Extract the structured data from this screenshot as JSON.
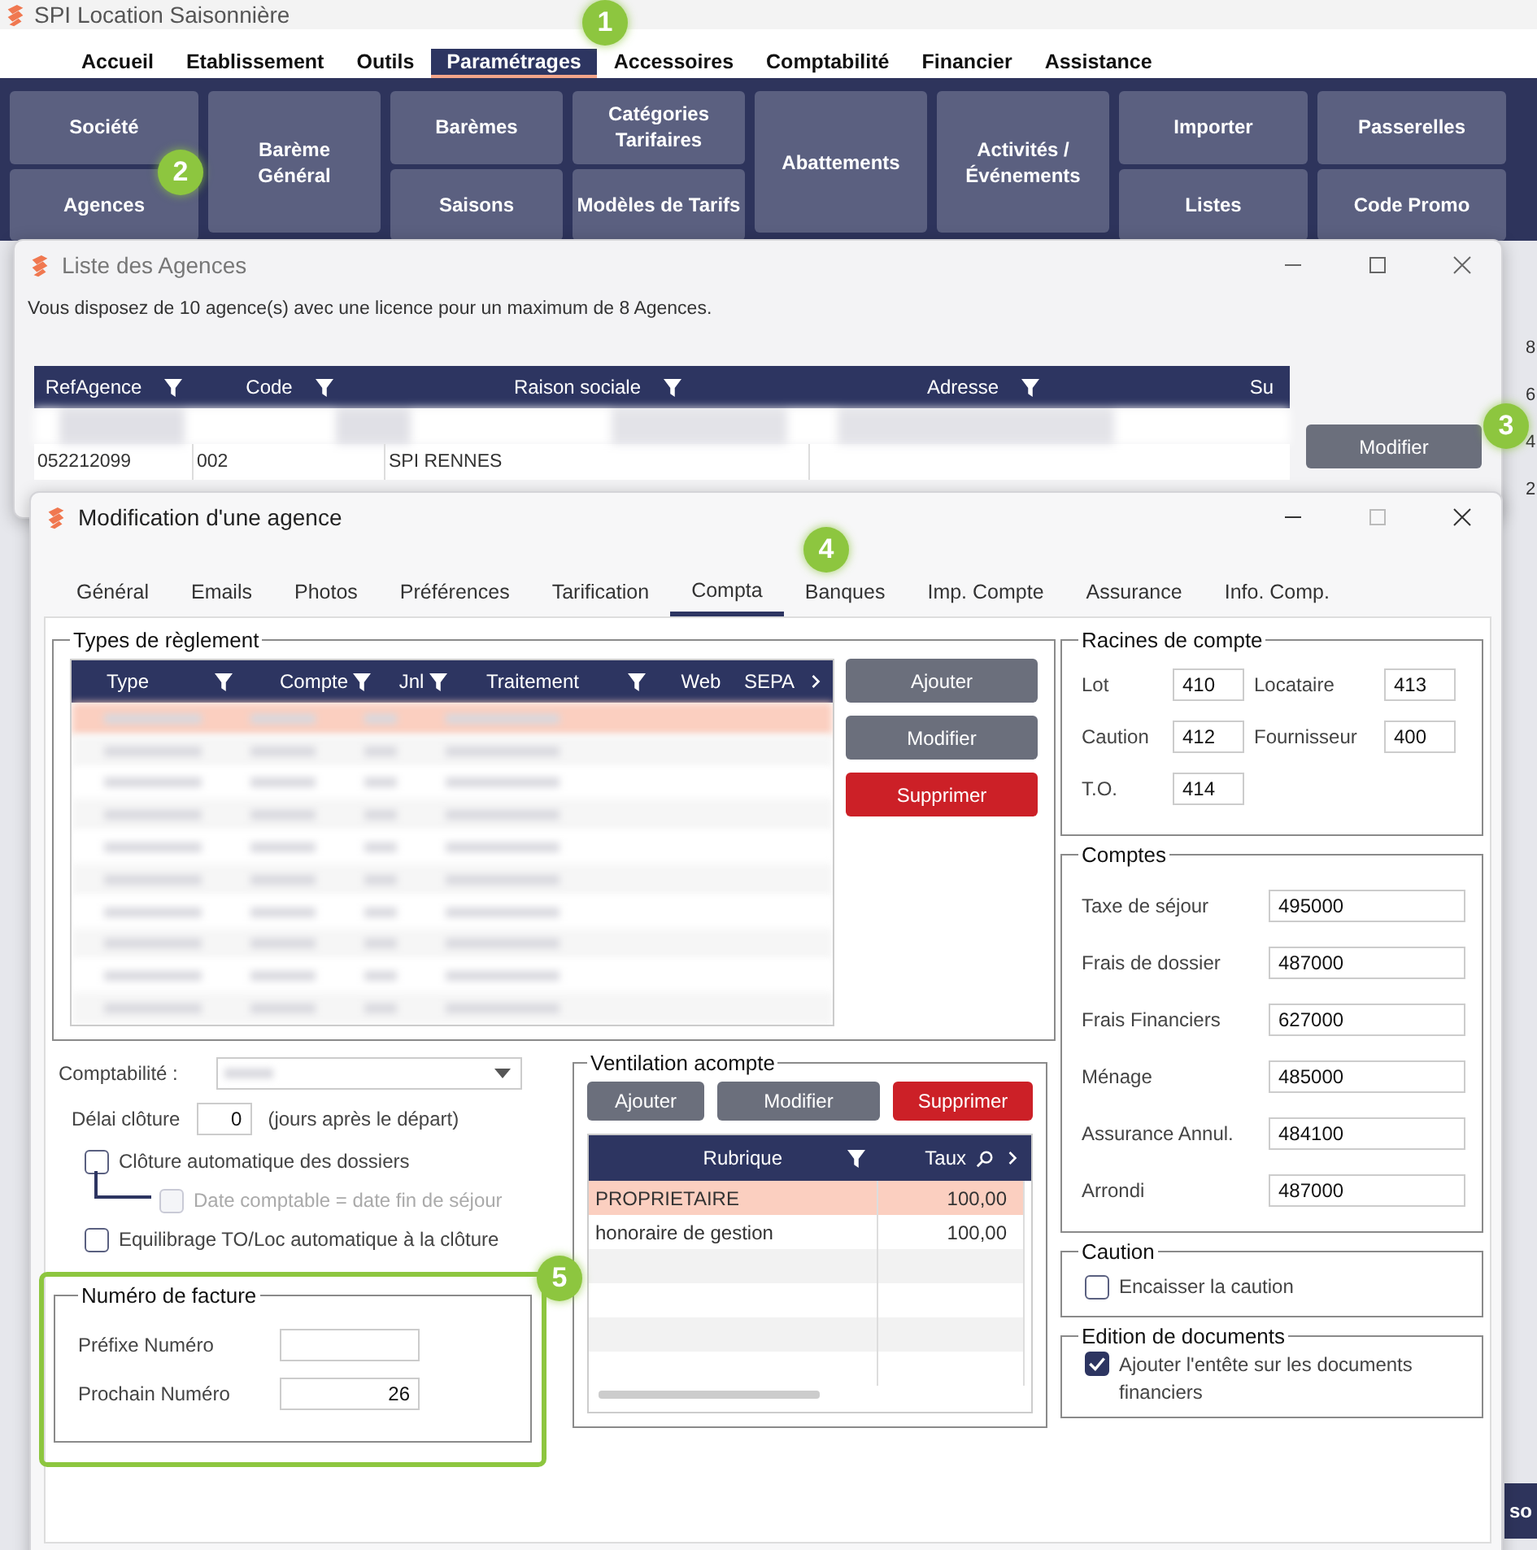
{
  "app": {
    "title": "SPI Location Saisonnière"
  },
  "menu": [
    {
      "label": "Accueil",
      "selected": false
    },
    {
      "label": "Etablissement",
      "selected": false
    },
    {
      "label": "Outils",
      "selected": false
    },
    {
      "label": "Paramétrages",
      "selected": true
    },
    {
      "label": "Accessoires",
      "selected": false
    },
    {
      "label": "Comptabilité",
      "selected": false
    },
    {
      "label": "Financier",
      "selected": false
    },
    {
      "label": "Assistance",
      "selected": false
    }
  ],
  "ribbon": [
    [
      "Société",
      "Agences"
    ],
    [
      "Barème\nGénéral"
    ],
    [
      "Barèmes",
      "Saisons"
    ],
    [
      "Catégories\nTarifaires",
      "Modèles de Tarifs"
    ],
    [
      "Abattements"
    ],
    [
      "Activités /\nÉvénements"
    ],
    [
      "Importer",
      "Listes"
    ],
    [
      "Passerelles",
      "Code Promo"
    ]
  ],
  "background_axis": [
    "8",
    "6",
    "4",
    "2"
  ],
  "background_fragment": "so",
  "agency_list": {
    "title": "Liste des Agences",
    "info": "Vous disposez de 10 agence(s) avec une licence pour un maximum de 8 Agences.",
    "columns": [
      {
        "label": "RefAgence",
        "filter": true
      },
      {
        "label": "Code",
        "filter": true
      },
      {
        "label": "Raison sociale",
        "filter": true
      },
      {
        "label": "Adresse",
        "filter": true
      },
      {
        "label": "Su",
        "filter": false
      }
    ],
    "visible_row": [
      "052212099",
      "002",
      "SPI RENNES"
    ],
    "button": "Modifier"
  },
  "dialog": {
    "title": "Modification d'une agence",
    "tabs": [
      {
        "label": "Général",
        "selected": false
      },
      {
        "label": "Emails",
        "selected": false
      },
      {
        "label": "Photos",
        "selected": false
      },
      {
        "label": "Préférences",
        "selected": false
      },
      {
        "label": "Tarification",
        "selected": false
      },
      {
        "label": "Compta",
        "selected": true
      },
      {
        "label": "Banques",
        "selected": false
      },
      {
        "label": "Imp. Compte",
        "selected": false
      },
      {
        "label": "Assurance",
        "selected": false
      },
      {
        "label": "Info. Comp.",
        "selected": false
      }
    ],
    "payment_types": {
      "title": "Types de règlement",
      "columns": [
        {
          "label": "Type",
          "filter": true
        },
        {
          "label": "Compte",
          "filter": true
        },
        {
          "label": "Jnl",
          "filter": true
        },
        {
          "label": "Traitement",
          "filter": true
        },
        {
          "label": "Web",
          "filter": false
        },
        {
          "label": "SEPA",
          "filter": false
        }
      ],
      "rows": [
        {
          "selected": true
        },
        {
          "selected": false
        },
        {
          "selected": false
        },
        {
          "selected": false
        },
        {
          "selected": false
        },
        {
          "selected": false
        },
        {
          "selected": false
        },
        {
          "selected": false
        },
        {
          "selected": false
        },
        {
          "selected": false
        }
      ],
      "buttons": [
        {
          "label": "Ajouter",
          "kind": "normal"
        },
        {
          "label": "Modifier",
          "kind": "normal"
        },
        {
          "label": "Supprimer",
          "kind": "danger"
        }
      ]
    },
    "accounting": {
      "label": "Comptabilité :"
    },
    "delay": {
      "label": "Délai clôture",
      "value": "0",
      "suffix": "(jours après le départ)"
    },
    "options": [
      {
        "label": "Clôture automatique des dossiers",
        "checked": false,
        "disabled": false,
        "kind": "main"
      },
      {
        "label": "Date comptable = date fin de séjour",
        "checked": false,
        "disabled": true,
        "kind": "sub"
      },
      {
        "label": "Equilibrage TO/Loc automatique à la clôture",
        "checked": false,
        "disabled": false,
        "kind": "main"
      }
    ],
    "invoice_number": {
      "title": "Numéro de facture",
      "fields": [
        {
          "label": "Préfixe Numéro"
        },
        {
          "label": "Prochain Numéro",
          "value": "26"
        }
      ]
    },
    "ventilation": {
      "title": "Ventilation acompte",
      "buttons": [
        {
          "label": "Ajouter",
          "kind": "normal"
        },
        {
          "label": "Modifier",
          "kind": "normal"
        },
        {
          "label": "Supprimer",
          "kind": "danger"
        }
      ],
      "columns": [
        "Rubrique",
        "Taux"
      ],
      "rows": [
        {
          "rubrique": "PROPRIETAIRE",
          "taux": "100,00",
          "selected": true
        },
        {
          "rubrique": "honoraire de gestion",
          "taux": "100,00",
          "selected": false
        }
      ]
    },
    "roots": {
      "title": "Racines de compte",
      "fields": [
        {
          "label": "Lot",
          "value": "410"
        },
        {
          "label": "Locataire",
          "value": "413"
        },
        {
          "label": "Caution",
          "value": "412"
        },
        {
          "label": "Fournisseur",
          "value": "400"
        },
        {
          "label": "T.O.",
          "value": "414"
        }
      ]
    },
    "accounts": {
      "title": "Comptes",
      "fields": [
        {
          "label": "Taxe de séjour",
          "value": "495000"
        },
        {
          "label": "Frais de dossier",
          "value": "487000"
        },
        {
          "label": "Frais Financiers",
          "value": "627000"
        },
        {
          "label": "Ménage",
          "value": "485000"
        },
        {
          "label": "Assurance Annul.",
          "value": "484100"
        },
        {
          "label": "Arrondi",
          "value": "487000"
        }
      ]
    },
    "caution": {
      "title": "Caution",
      "option": {
        "label": "Encaisser la caution",
        "checked": false
      }
    },
    "documents": {
      "title": "Edition de documents",
      "option": {
        "label": "Ajouter l'entête sur les documents financiers",
        "checked": true
      }
    }
  },
  "callouts": [
    "1",
    "2",
    "3",
    "4",
    "5"
  ]
}
